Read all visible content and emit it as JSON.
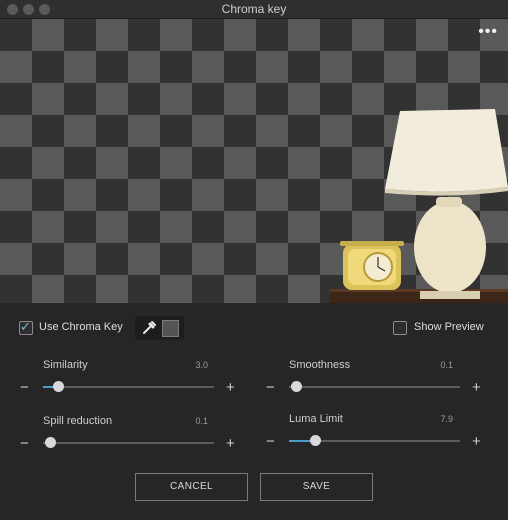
{
  "window": {
    "title": "Chroma key",
    "traffic_lights": [
      "close",
      "minimize",
      "zoom"
    ]
  },
  "preview": {
    "menu_icon": "more-dots-icon",
    "menu_glyph": "•••",
    "checker_colors": [
      "#323232",
      "#595959"
    ]
  },
  "options": {
    "use_chroma_key": {
      "label": "Use Chroma Key",
      "checked": true,
      "check_glyph": "✓"
    },
    "show_preview": {
      "label": "Show Preview",
      "checked": false
    },
    "eyedropper_icon": "eyedropper-icon",
    "key_color": "#545456"
  },
  "sliders": [
    {
      "id": "similarity",
      "label": "Similarity",
      "value": "3.0",
      "level": 0.05,
      "minus": "−",
      "plus": "+"
    },
    {
      "id": "smoothness",
      "label": "Smoothness",
      "value": "0.1",
      "level": 0.0,
      "minus": "−",
      "plus": "+"
    },
    {
      "id": "spill_reduction",
      "label": "Spill reduction",
      "value": "0.1",
      "level": 0.0,
      "minus": "−",
      "plus": "+"
    },
    {
      "id": "luma_limit",
      "label": "Luma Limit",
      "value": "7.9",
      "level": 0.11,
      "minus": "−",
      "plus": "+"
    }
  ],
  "buttons": {
    "cancel": "CANCEL",
    "save": "SAVE"
  },
  "colors": {
    "accent": "#4b9cc4",
    "panel": "#262628",
    "text": "#d4d4d6"
  }
}
